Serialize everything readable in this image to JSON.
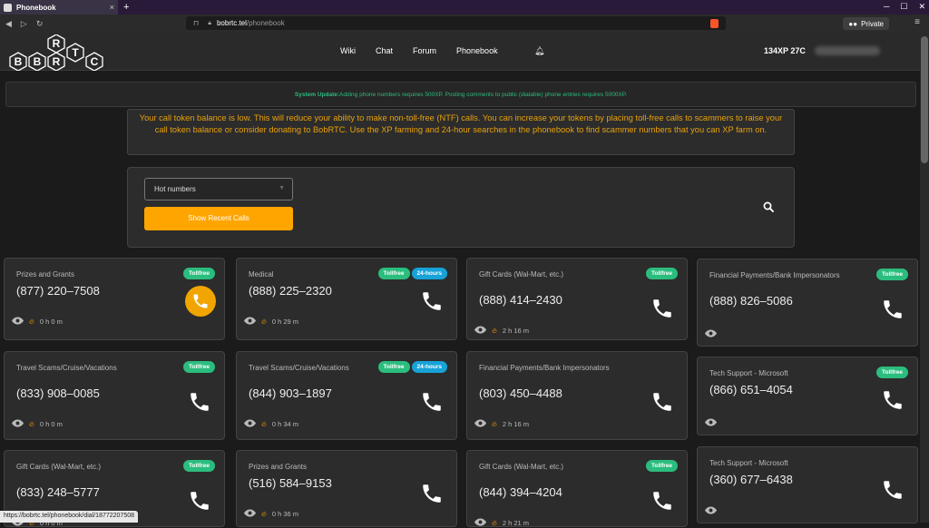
{
  "browser": {
    "tab_title": "Phonebook",
    "tab_close": "×",
    "new_tab": "+",
    "url_host": "bobrtc.tel",
    "url_path": "/phonebook",
    "private_label": "Private",
    "status_url": "https://bobrtc.tel/phonebook/dial/18772207508"
  },
  "site": {
    "logo_letters": [
      "B",
      "B",
      "R",
      "T",
      "C",
      "R"
    ],
    "nav": [
      "Wiki",
      "Chat",
      "Forum",
      "Phonebook"
    ],
    "xp": "134XP 27C"
  },
  "notices": {
    "system_label": "System Update:",
    "system_text": " Adding phone numbers requires 500XP. Posting comments to public (dialable) phone entries requires 5000XP.",
    "warning": "Your call token balance is low. This will reduce your ability to make non-toll-free (NTF) calls. You can increase your tokens by placing toll-free calls to scammers to raise your call token balance or consider donating to BobRTC. Use the XP farming and 24-hour searches in the phonebook to find scammer numbers that you can XP farm on."
  },
  "search": {
    "select_value": "Hot numbers",
    "recent_button": "Show Recent Calls"
  },
  "colors": {
    "accent": "#ffa500",
    "tollfree": "#2bbd7e",
    "hours24": "#17a2d8",
    "warning": "#e8a10b"
  },
  "cards": [
    {
      "category": "Prizes and Grants",
      "number": "(877) 220–7508",
      "badges": [
        "Tollfree"
      ],
      "stats": "0 h 0 m",
      "highlight": true
    },
    {
      "category": "Medical",
      "number": "(888) 225–2320",
      "badges": [
        "Tollfree",
        "24-hours"
      ],
      "stats": "0 h 29 m"
    },
    {
      "category": "Gift Cards (Wal-Mart, etc.)",
      "number": "(888) 414–2430",
      "badges": [
        "Tollfree"
      ],
      "stats": "2 h 16 m"
    },
    {
      "category": "Financial Payments/Bank Impersonators",
      "number": "(888) 826–5086",
      "badges": [
        "Tollfree"
      ],
      "stats": ""
    },
    {
      "category": "Travel Scams/Cruise/Vacations",
      "number": "(833) 908–0085",
      "badges": [
        "Tollfree"
      ],
      "stats": "0 h 0 m"
    },
    {
      "category": "Travel Scams/Cruise/Vacations",
      "number": "(844) 903–1897",
      "badges": [
        "Tollfree",
        "24-hours"
      ],
      "stats": "0 h 34 m"
    },
    {
      "category": "Financial Payments/Bank Impersonators",
      "number": "(803) 450–4488",
      "badges": [],
      "stats": "2 h 16 m"
    },
    {
      "category": "Tech Support - Microsoft",
      "number": "(866) 651–4054",
      "badges": [
        "Tollfree"
      ],
      "stats": ""
    },
    {
      "category": "Gift Cards (Wal-Mart, etc.)",
      "number": "(833) 248–5777",
      "badges": [
        "Tollfree"
      ],
      "stats": "0 h 0 m"
    },
    {
      "category": "Prizes and Grants",
      "number": "(516) 584–9153",
      "badges": [],
      "stats": "0 h 36 m"
    },
    {
      "category": "Gift Cards (Wal-Mart, etc.)",
      "number": "(844) 394–4204",
      "badges": [
        "Tollfree"
      ],
      "stats": "2 h 21 m"
    },
    {
      "category": "Tech Support - Microsoft",
      "number": "(360) 677–6438",
      "badges": [],
      "stats": ""
    }
  ]
}
